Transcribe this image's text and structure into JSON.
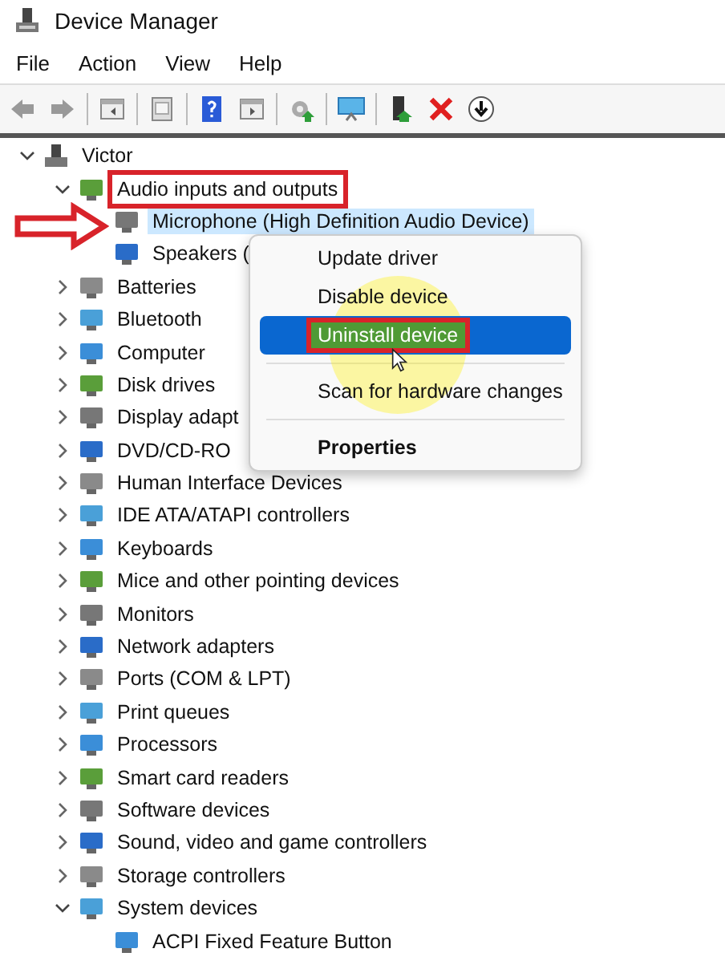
{
  "window": {
    "title": "Device Manager"
  },
  "menu_bar": [
    "File",
    "Action",
    "View",
    "Help"
  ],
  "tree": {
    "label": "Victor",
    "expanded": true,
    "children": [
      {
        "label": "Audio inputs and outputs",
        "expanded": true,
        "annotated": true,
        "children": [
          {
            "label": "Microphone (High Definition Audio Device)",
            "selected": true
          },
          {
            "label": "Speakers (",
            "selected": false
          }
        ]
      },
      {
        "label": "Batteries",
        "expanded": false
      },
      {
        "label": "Bluetooth",
        "expanded": false
      },
      {
        "label": "Computer",
        "expanded": false
      },
      {
        "label": "Disk drives",
        "expanded": false
      },
      {
        "label": "Display adapt",
        "expanded": false
      },
      {
        "label": "DVD/CD-RO",
        "expanded": false
      },
      {
        "label": "Human Interface Devices",
        "expanded": false
      },
      {
        "label": "IDE ATA/ATAPI controllers",
        "expanded": false
      },
      {
        "label": "Keyboards",
        "expanded": false
      },
      {
        "label": "Mice and other pointing devices",
        "expanded": false
      },
      {
        "label": "Monitors",
        "expanded": false
      },
      {
        "label": "Network adapters",
        "expanded": false
      },
      {
        "label": "Ports (COM & LPT)",
        "expanded": false
      },
      {
        "label": "Print queues",
        "expanded": false
      },
      {
        "label": "Processors",
        "expanded": false
      },
      {
        "label": "Smart card readers",
        "expanded": false
      },
      {
        "label": "Software devices",
        "expanded": false
      },
      {
        "label": "Sound, video and game controllers",
        "expanded": false
      },
      {
        "label": "Storage controllers",
        "expanded": false
      },
      {
        "label": "System devices",
        "expanded": true,
        "children": [
          {
            "label": "ACPI Fixed Feature Button",
            "selected": false
          }
        ]
      }
    ]
  },
  "context_menu": [
    {
      "kind": "item",
      "label": "Update driver",
      "selected": false
    },
    {
      "kind": "item",
      "label": "Disable device",
      "selected": false
    },
    {
      "kind": "item",
      "label": "Uninstall device",
      "selected": true,
      "annotated": true
    },
    {
      "kind": "separator"
    },
    {
      "kind": "item",
      "label": "Scan for hardware changes",
      "selected": false
    },
    {
      "kind": "separator"
    },
    {
      "kind": "default",
      "label": "Properties",
      "selected": false
    }
  ]
}
